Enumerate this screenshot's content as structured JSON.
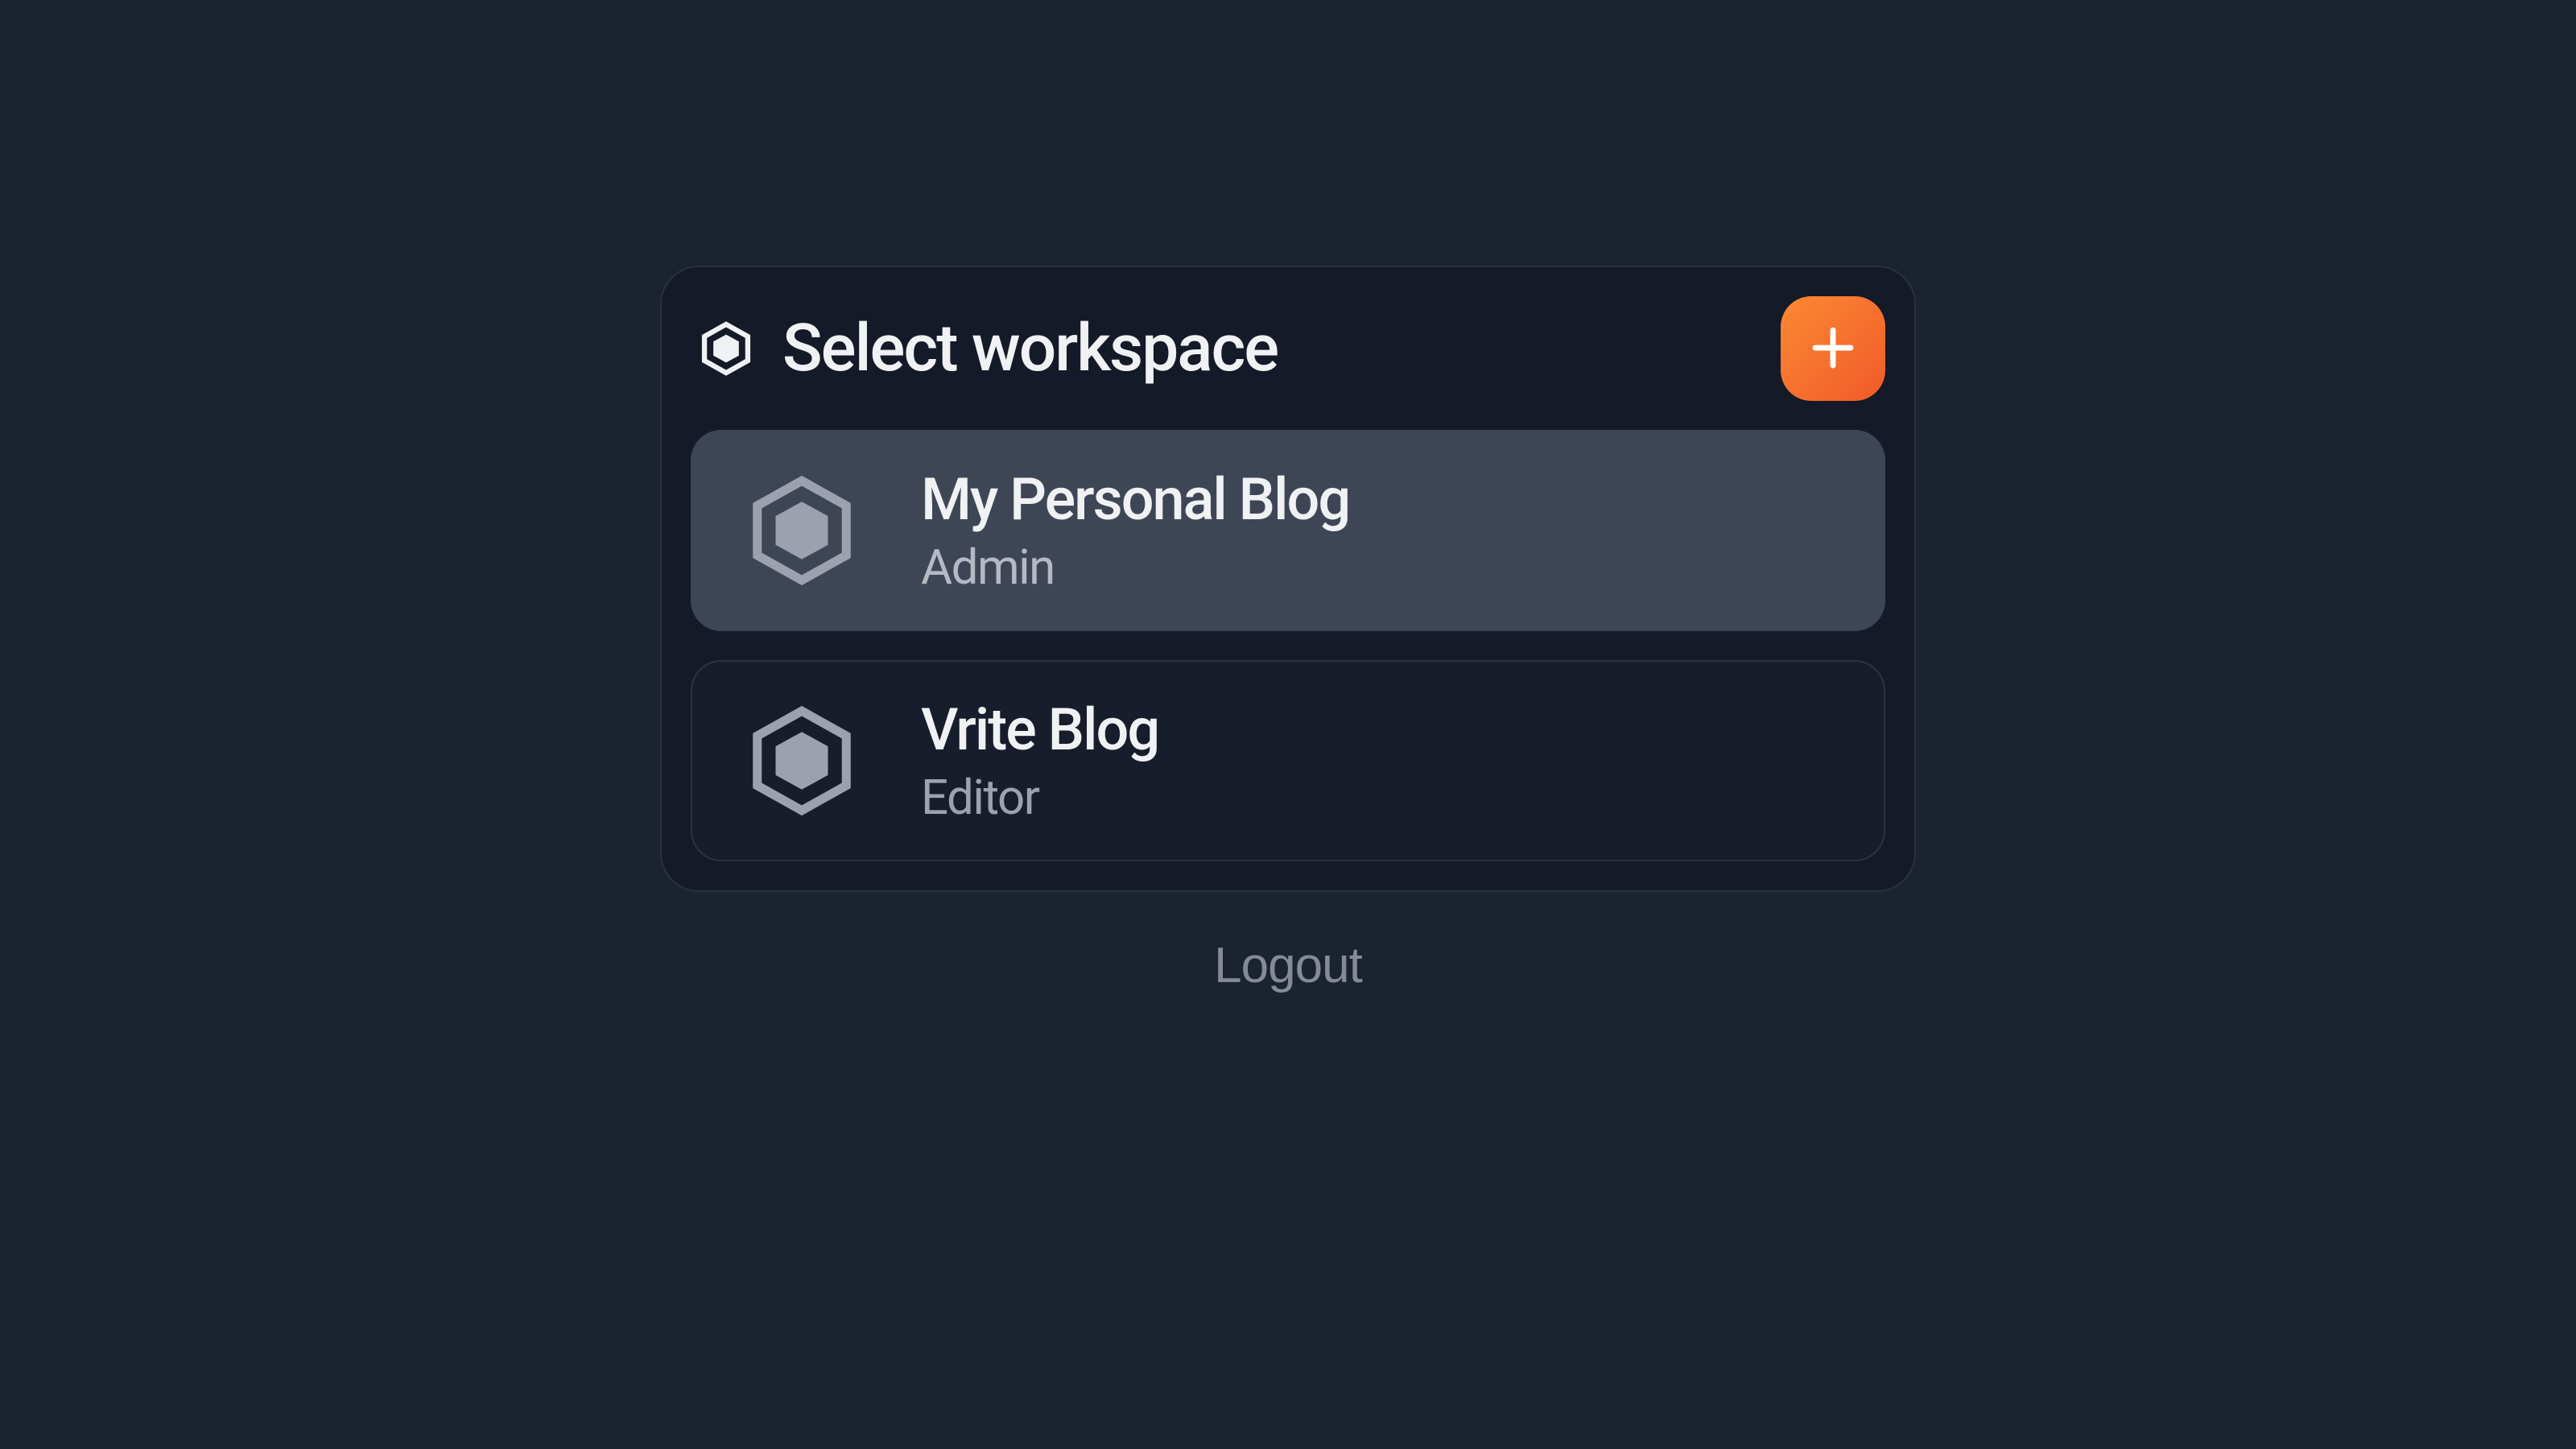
{
  "header": {
    "title": "Select workspace"
  },
  "workspaces": [
    {
      "name": "My Personal Blog",
      "role": "Admin",
      "selected": true
    },
    {
      "name": "Vrite Blog",
      "role": "Editor",
      "selected": false
    }
  ],
  "logout_label": "Logout"
}
